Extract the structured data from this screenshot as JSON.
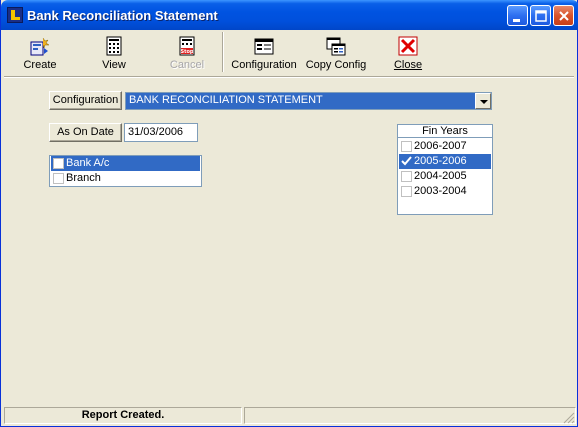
{
  "window": {
    "title": "Bank Reconciliation Statement"
  },
  "toolbar": {
    "create": "Create",
    "view": "View",
    "cancel": "Cancel",
    "configuration": "Configuration",
    "copy_config": "Copy Config",
    "close": "Close"
  },
  "form": {
    "configuration_label": "Configuration",
    "configuration_value": "BANK RECONCILIATION STATEMENT",
    "as_on_date_label": "As On Date",
    "as_on_date_value": "31/03/2006"
  },
  "selection_list": [
    {
      "label": "Bank A/c",
      "checked": false,
      "selected": true
    },
    {
      "label": "Branch",
      "checked": false,
      "selected": false
    }
  ],
  "fin_years": {
    "header": "Fin Years",
    "items": [
      {
        "label": "2006-2007",
        "checked": false,
        "selected": false
      },
      {
        "label": "2005-2006",
        "checked": true,
        "selected": true
      },
      {
        "label": "2004-2005",
        "checked": false,
        "selected": false
      },
      {
        "label": "2003-2004",
        "checked": false,
        "selected": false
      }
    ]
  },
  "status": {
    "message": "Report Created."
  },
  "icons": [
    "app-icon",
    "minimize-icon",
    "maximize-icon",
    "close-window-icon",
    "create-icon",
    "view-icon",
    "cancel-stop-icon",
    "configuration-icon",
    "copy-config-icon",
    "close-red-x-icon",
    "dropdown-arrow-icon",
    "checkmark-icon",
    "size-grip-icon"
  ],
  "colors": {
    "titlebar": "#0053E1",
    "selection": "#316AC5",
    "face": "#ECE9D8"
  }
}
